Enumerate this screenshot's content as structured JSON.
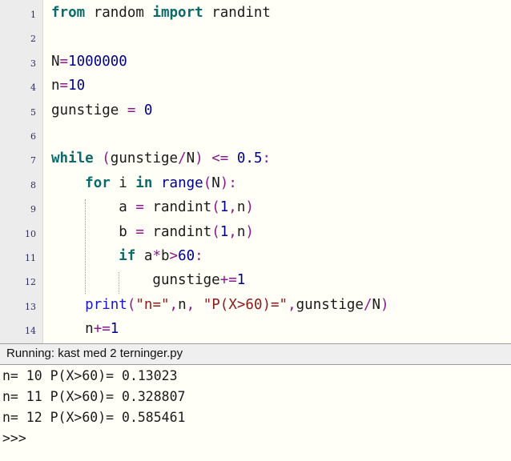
{
  "window": {
    "app": "python-idle-editor"
  },
  "editor": {
    "gutter_numbers": [
      "1",
      "2",
      "3",
      "4",
      "5",
      "6",
      "7",
      "8",
      "9",
      "10",
      "11",
      "12",
      "13",
      "14"
    ],
    "lines": [
      {
        "n": "1",
        "tokens": [
          {
            "t": "from",
            "c": "kw"
          },
          {
            "t": " random ",
            "c": "pl"
          },
          {
            "t": "import",
            "c": "kw"
          },
          {
            "t": " randint",
            "c": "pl"
          }
        ]
      },
      {
        "n": "2",
        "tokens": []
      },
      {
        "n": "3",
        "tokens": [
          {
            "t": "N",
            "c": "pl"
          },
          {
            "t": "=",
            "c": "op"
          },
          {
            "t": "1000000",
            "c": "num"
          }
        ]
      },
      {
        "n": "4",
        "tokens": [
          {
            "t": "n",
            "c": "pl"
          },
          {
            "t": "=",
            "c": "op"
          },
          {
            "t": "10",
            "c": "num"
          }
        ]
      },
      {
        "n": "5",
        "tokens": [
          {
            "t": "gunstige ",
            "c": "pl"
          },
          {
            "t": "=",
            "c": "op"
          },
          {
            "t": " ",
            "c": "pl"
          },
          {
            "t": "0",
            "c": "num"
          }
        ]
      },
      {
        "n": "6",
        "tokens": []
      },
      {
        "n": "7",
        "tokens": [
          {
            "t": "while",
            "c": "kw"
          },
          {
            "t": " ",
            "c": "pl"
          },
          {
            "t": "(",
            "c": "op"
          },
          {
            "t": "gunstige",
            "c": "pl"
          },
          {
            "t": "/",
            "c": "op"
          },
          {
            "t": "N",
            "c": "pl"
          },
          {
            "t": ")",
            "c": "op"
          },
          {
            "t": " ",
            "c": "pl"
          },
          {
            "t": "<=",
            "c": "op"
          },
          {
            "t": " ",
            "c": "pl"
          },
          {
            "t": "0.5",
            "c": "num"
          },
          {
            "t": ":",
            "c": "op"
          }
        ]
      },
      {
        "n": "8",
        "tokens": [
          {
            "t": "    ",
            "c": "pl"
          },
          {
            "t": "for",
            "c": "kw"
          },
          {
            "t": " i ",
            "c": "pl"
          },
          {
            "t": "in",
            "c": "kw"
          },
          {
            "t": " ",
            "c": "pl"
          },
          {
            "t": "range",
            "c": "bi"
          },
          {
            "t": "(",
            "c": "op"
          },
          {
            "t": "N",
            "c": "pl"
          },
          {
            "t": ")",
            "c": "op"
          },
          {
            "t": ":",
            "c": "op"
          }
        ]
      },
      {
        "n": "9",
        "tokens": [
          {
            "t": "        a ",
            "c": "pl"
          },
          {
            "t": "=",
            "c": "op"
          },
          {
            "t": " randint",
            "c": "pl"
          },
          {
            "t": "(",
            "c": "op"
          },
          {
            "t": "1",
            "c": "num"
          },
          {
            "t": ",",
            "c": "op"
          },
          {
            "t": "n",
            "c": "pl"
          },
          {
            "t": ")",
            "c": "op"
          }
        ]
      },
      {
        "n": "10",
        "tokens": [
          {
            "t": "        b ",
            "c": "pl"
          },
          {
            "t": "=",
            "c": "op"
          },
          {
            "t": " randint",
            "c": "pl"
          },
          {
            "t": "(",
            "c": "op"
          },
          {
            "t": "1",
            "c": "num"
          },
          {
            "t": ",",
            "c": "op"
          },
          {
            "t": "n",
            "c": "pl"
          },
          {
            "t": ")",
            "c": "op"
          }
        ]
      },
      {
        "n": "11",
        "tokens": [
          {
            "t": "        ",
            "c": "pl"
          },
          {
            "t": "if",
            "c": "kw"
          },
          {
            "t": " a",
            "c": "pl"
          },
          {
            "t": "*",
            "c": "op"
          },
          {
            "t": "b",
            "c": "pl"
          },
          {
            "t": ">",
            "c": "op"
          },
          {
            "t": "60",
            "c": "num"
          },
          {
            "t": ":",
            "c": "op"
          }
        ]
      },
      {
        "n": "12",
        "tokens": [
          {
            "t": "            gunstige",
            "c": "pl"
          },
          {
            "t": "+=",
            "c": "op"
          },
          {
            "t": "1",
            "c": "num"
          }
        ]
      },
      {
        "n": "13",
        "tokens": [
          {
            "t": "    ",
            "c": "pl"
          },
          {
            "t": "print",
            "c": "fn"
          },
          {
            "t": "(",
            "c": "op"
          },
          {
            "t": "\"n=\"",
            "c": "str"
          },
          {
            "t": ",",
            "c": "op"
          },
          {
            "t": "n",
            "c": "pl"
          },
          {
            "t": ",",
            "c": "op"
          },
          {
            "t": " ",
            "c": "pl"
          },
          {
            "t": "\"P(X>60)=\"",
            "c": "str"
          },
          {
            "t": ",",
            "c": "op"
          },
          {
            "t": "gunstige",
            "c": "pl"
          },
          {
            "t": "/",
            "c": "op"
          },
          {
            "t": "N",
            "c": "pl"
          },
          {
            "t": ")",
            "c": "op"
          }
        ]
      },
      {
        "n": "14",
        "tokens": [
          {
            "t": "    n",
            "c": "pl"
          },
          {
            "t": "+=",
            "c": "op"
          },
          {
            "t": "1",
            "c": "num"
          }
        ]
      }
    ],
    "plain_text": [
      "from random import randint",
      "",
      "N=1000000",
      "n=10",
      "gunstige = 0",
      "",
      "while (gunstige/N) <= 0.5:",
      "    for i in range(N):",
      "        a = randint(1,n)",
      "        b = randint(1,n)",
      "        if a*b>60:",
      "            gunstige+=1",
      "    print(\"n=\",n, \"P(X>60)=\",gunstige/N)",
      "    n+=1"
    ]
  },
  "statusbar": {
    "text": "Running: kast med 2 terninger.py",
    "filename": "kast med 2 terninger.py",
    "state": "Running"
  },
  "output": {
    "lines": [
      "n= 10 P(X>60)= 0.13023",
      "n= 11 P(X>60)= 0.328807",
      "n= 12 P(X>60)= 0.585461",
      ">>>"
    ],
    "prompt": ">>>",
    "results": [
      {
        "n": "10",
        "label": "P(X>60)=",
        "value": "0.13023"
      },
      {
        "n": "11",
        "label": "P(X>60)=",
        "value": "0.328807"
      },
      {
        "n": "12",
        "label": "P(X>60)=",
        "value": "0.585461"
      }
    ]
  },
  "colors": {
    "editor_bg": "#fffff7",
    "gutter_bg": "#ececec",
    "statusbar_bg": "#efefef",
    "keyword": "#0b6a6a",
    "number": "#00008b",
    "builtin": "#00008b",
    "function": "#1818c8",
    "string": "#8b1a1a",
    "operator": "#8a1a8a",
    "linenumber": "#2c2c66"
  }
}
